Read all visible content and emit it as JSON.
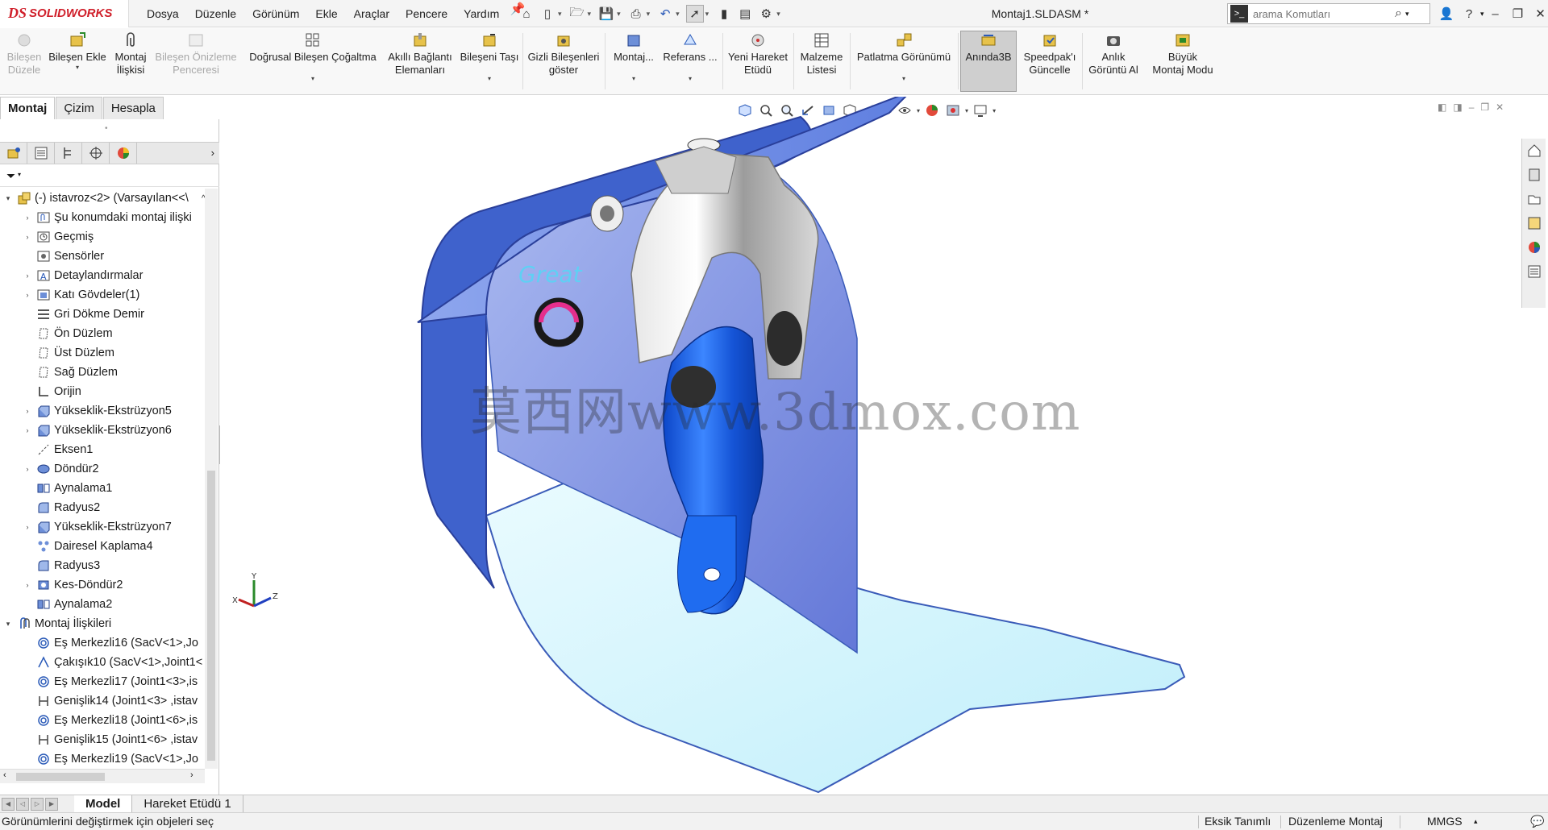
{
  "app": {
    "logo_prefix": "DS",
    "logo_text": "SOLIDWORKS",
    "document_title": "Montaj1.SLDASM *"
  },
  "menu": [
    "Dosya",
    "Düzenle",
    "Görünüm",
    "Ekle",
    "Araçlar",
    "Pencere",
    "Yardım"
  ],
  "search": {
    "placeholder": "arama Komutları",
    "value": ""
  },
  "toolbar": {
    "items": [
      {
        "label": "Bileşen\nDüzele",
        "enabled": false
      },
      {
        "label": "Bileşen Ekle",
        "enabled": true,
        "dropdown": true
      },
      {
        "label": "Montaj\nİlişkisi",
        "enabled": true
      },
      {
        "label": "Bileşen Önizleme\nPenceresi",
        "enabled": false
      },
      {
        "label": "Doğrusal Bileşen Çoğaltma",
        "enabled": true,
        "dropdown": true
      },
      {
        "label": "Akıllı Bağlantı\nElemanları",
        "enabled": true
      },
      {
        "label": "Bileşeni Taşı",
        "enabled": true,
        "dropdown": true
      },
      {
        "label": "Gizli Bileşenleri\ngöster",
        "enabled": true
      },
      {
        "label": "Montaj...",
        "enabled": true,
        "dropdown": true
      },
      {
        "label": "Referans ...",
        "enabled": true,
        "dropdown": true
      },
      {
        "label": "Yeni Hareket\nEtüdü",
        "enabled": true
      },
      {
        "label": "Malzeme\nListesi",
        "enabled": true
      },
      {
        "label": "Patlatma Görünümü",
        "enabled": true,
        "dropdown": true
      },
      {
        "label": "Anında3B",
        "enabled": true,
        "active": true
      },
      {
        "label": "Speedpak'ı\nGüncelle",
        "enabled": true
      },
      {
        "label": "Anlık\nGörüntü Al",
        "enabled": true
      },
      {
        "label": "Büyük\nMontaj Modu",
        "enabled": true
      }
    ]
  },
  "panel_tabs": [
    "Montaj",
    "Çizim",
    "Hesapla"
  ],
  "tree": {
    "root": "(-) istavroz<2> (Varsayılan<<\\",
    "nodes": [
      {
        "label": "Şu konumdaki montaj ilişki",
        "icon": "mates-folder-icon",
        "expand": true
      },
      {
        "label": "Geçmiş",
        "icon": "history-icon",
        "expand": true
      },
      {
        "label": "Sensörler",
        "icon": "sensor-icon",
        "expand": false
      },
      {
        "label": "Detaylandırmalar",
        "icon": "annotation-icon",
        "expand": true
      },
      {
        "label": "Katı Gövdeler(1)",
        "icon": "solid-bodies-icon",
        "expand": true
      },
      {
        "label": "Gri Dökme Demir",
        "icon": "material-icon",
        "expand": false
      },
      {
        "label": "Ön Düzlem",
        "icon": "plane-icon",
        "expand": false
      },
      {
        "label": "Üst Düzlem",
        "icon": "plane-icon",
        "expand": false
      },
      {
        "label": "Sağ Düzlem",
        "icon": "plane-icon",
        "expand": false
      },
      {
        "label": "Orijin",
        "icon": "origin-icon",
        "expand": false
      },
      {
        "label": "Yükseklik-Ekstrüzyon5",
        "icon": "extrude-icon",
        "expand": true
      },
      {
        "label": "Yükseklik-Ekstrüzyon6",
        "icon": "extrude-icon",
        "expand": true
      },
      {
        "label": "Eksen1",
        "icon": "axis-icon",
        "expand": false
      },
      {
        "label": "Döndür2",
        "icon": "revolve-icon",
        "expand": true
      },
      {
        "label": "Aynalama1",
        "icon": "mirror-icon",
        "expand": false
      },
      {
        "label": "Radyus2",
        "icon": "fillet-icon",
        "expand": false
      },
      {
        "label": "Yükseklik-Ekstrüzyon7",
        "icon": "extrude-icon",
        "expand": true
      },
      {
        "label": "Dairesel Kaplama4",
        "icon": "circular-pattern-icon",
        "expand": false
      },
      {
        "label": "Radyus3",
        "icon": "fillet-icon",
        "expand": false
      },
      {
        "label": "Kes-Döndür2",
        "icon": "cut-revolve-icon",
        "expand": true
      },
      {
        "label": "Aynalama2",
        "icon": "mirror-icon",
        "expand": false
      }
    ],
    "mates_folder": "Montaj İlişkileri",
    "mates": [
      {
        "label": "Eş Merkezli16 (SacV<1>,Jo",
        "icon": "concentric-icon"
      },
      {
        "label": "Çakışık10 (SacV<1>,Joint1<",
        "icon": "coincident-icon"
      },
      {
        "label": "Eş Merkezli17 (Joint1<3>,is",
        "icon": "concentric-icon"
      },
      {
        "label": "Genişlik14 (Joint1<3> ,istav",
        "icon": "width-icon"
      },
      {
        "label": "Eş Merkezli18 (Joint1<6>,is",
        "icon": "concentric-icon"
      },
      {
        "label": "Genişlik15 (Joint1<6> ,istav",
        "icon": "width-icon"
      },
      {
        "label": "Eş Merkezli19 (SacV<1>,Jo",
        "icon": "concentric-icon"
      }
    ]
  },
  "viewport": {
    "watermark": "莫西网www.3dmox.com",
    "logo_text": "Great",
    "triad": {
      "x": "X",
      "y": "Y",
      "z": "Z"
    }
  },
  "bottom_tabs": [
    "Model",
    "Hareket Etüdü 1"
  ],
  "status": {
    "message": "Görünümlerini değiştirmek için objeleri seç",
    "definition": "Eksik Tanımlı",
    "mode": "Düzenleme Montaj",
    "units": "MMGS"
  },
  "colors": {
    "part_blue": "#1f5fd6",
    "sheet_blue": "#6f8fe0",
    "floor_cyan": "#cdf3fb",
    "brand_red": "#d0202b"
  }
}
